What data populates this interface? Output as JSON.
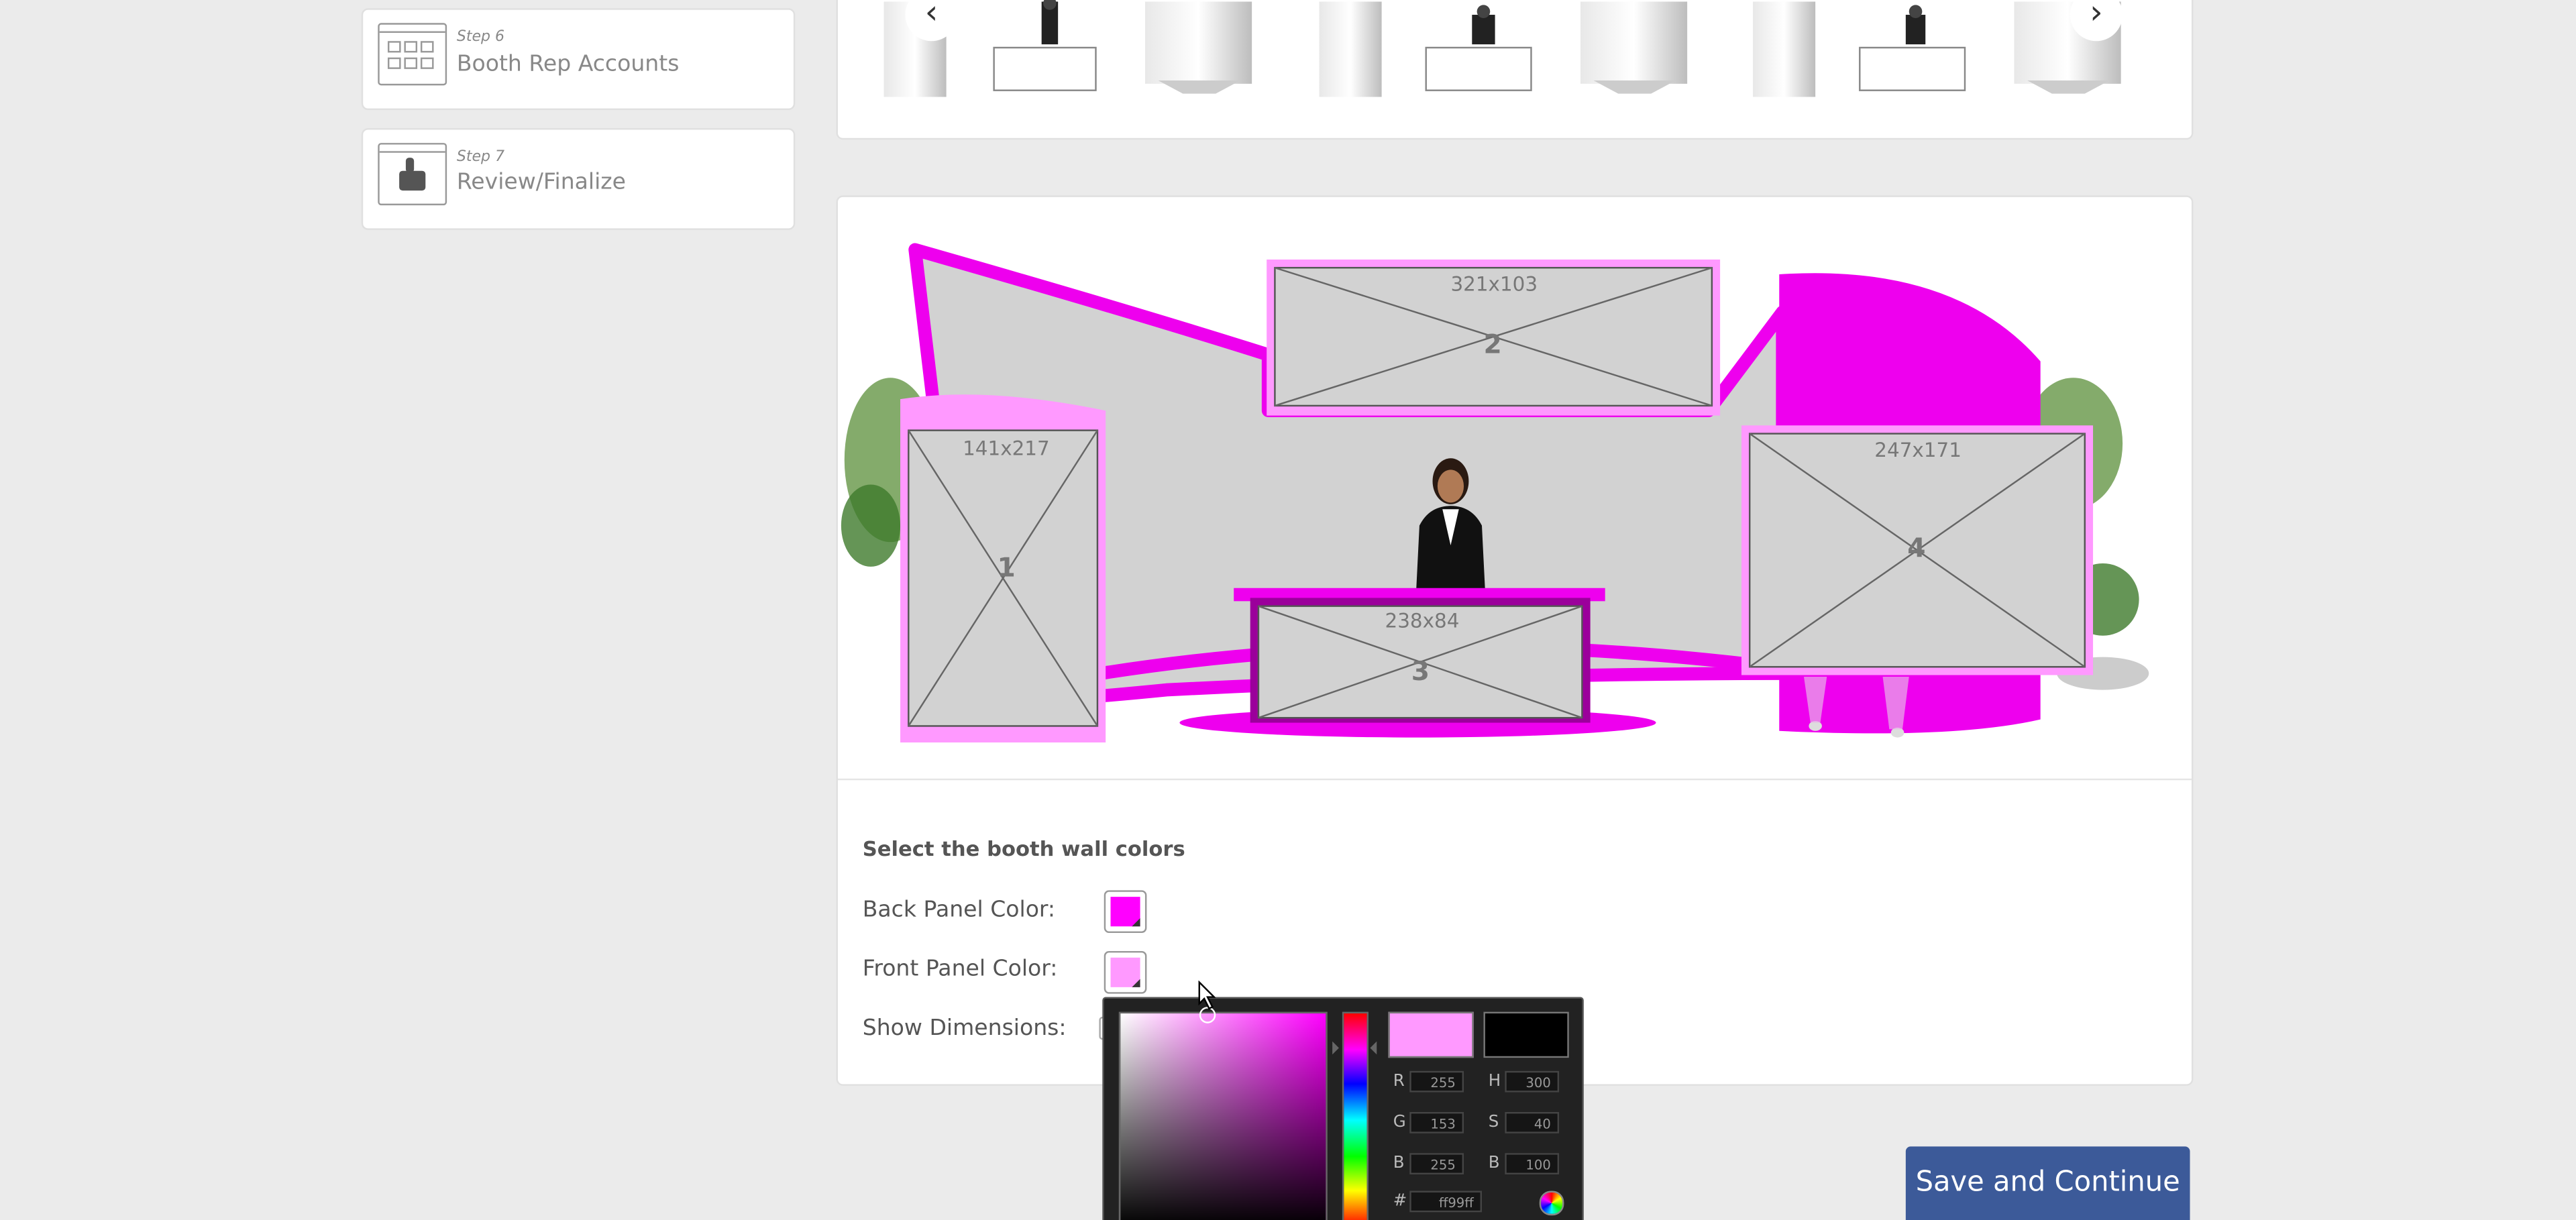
{
  "sidebar": {
    "steps": [
      {
        "number": "Step 6",
        "title": "Booth Rep Accounts",
        "icon": "booth-rep-accounts-icon"
      },
      {
        "number": "Step 7",
        "title": "Review/Finalize",
        "icon": "review-finalize-icon"
      }
    ]
  },
  "carousel": {
    "prev_icon": "chevron-left-icon",
    "next_icon": "chevron-right-icon",
    "prev_glyph": "‹",
    "next_glyph": "›"
  },
  "booth": {
    "panels": [
      {
        "dim": "141x217",
        "num": "1"
      },
      {
        "dim": "321x103",
        "num": "2"
      },
      {
        "dim": "238x84",
        "num": "3"
      },
      {
        "dim": "247x171",
        "num": "4"
      }
    ],
    "back_color": "#ee00ee",
    "front_color": "#ff99ff"
  },
  "colors_form": {
    "heading": "Select the booth wall colors",
    "back_panel_label": "Back Panel Color:",
    "front_panel_label": "Front Panel Color:",
    "show_dimensions_label": "Show Dimensions:",
    "back_swatch_color": "#ff00ff",
    "front_swatch_color": "#ff99ff"
  },
  "picker": {
    "current_color": "#ff99ff",
    "previous_color": "#000000",
    "r": "255",
    "g": "153",
    "b": "255",
    "h": "300",
    "s": "40",
    "bv": "100",
    "hex": "ff99ff"
  },
  "actions": {
    "save_label": "Save and Continue"
  }
}
